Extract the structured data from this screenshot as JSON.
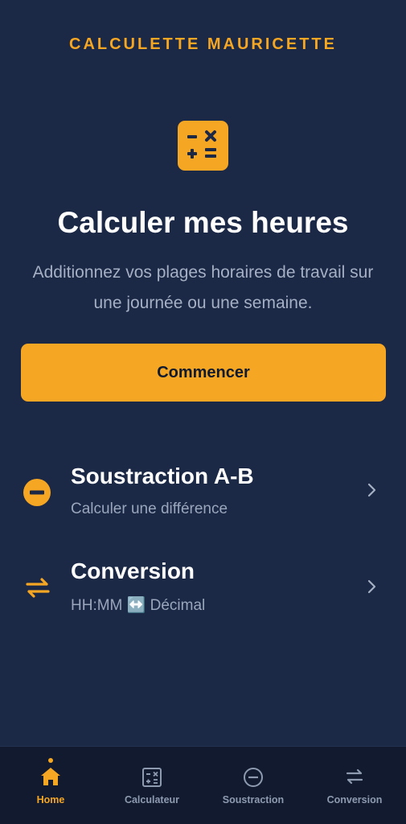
{
  "app": {
    "title": "CALCULETTE MAURICETTE"
  },
  "hero": {
    "icon": "calculator-icon",
    "title": "Calculer mes heures",
    "subtitle": "Additionnez vos plages horaires de travail sur une journée ou une semaine.",
    "start_label": "Commencer"
  },
  "tools": [
    {
      "icon": "minus-circle-icon",
      "title": "Soustraction A-B",
      "subtitle": "Calculer une différence"
    },
    {
      "icon": "swap-arrows-icon",
      "title": "Conversion",
      "subtitle_left": "HH:MM",
      "subtitle_icon": "↔️",
      "subtitle_right": "Décimal"
    }
  ],
  "nav": {
    "active": "home",
    "items": [
      {
        "label": "Home",
        "icon": "home-icon"
      },
      {
        "label": "Calculateur",
        "icon": "calculator-icon"
      },
      {
        "label": "Soustraction",
        "icon": "minus-circle-icon"
      },
      {
        "label": "Conversion",
        "icon": "swap-arrows-icon"
      }
    ]
  },
  "colors": {
    "background": "#1b2846",
    "accent": "#f5a623",
    "nav_background": "#111a2f",
    "muted_text": "#a5b0c4"
  }
}
